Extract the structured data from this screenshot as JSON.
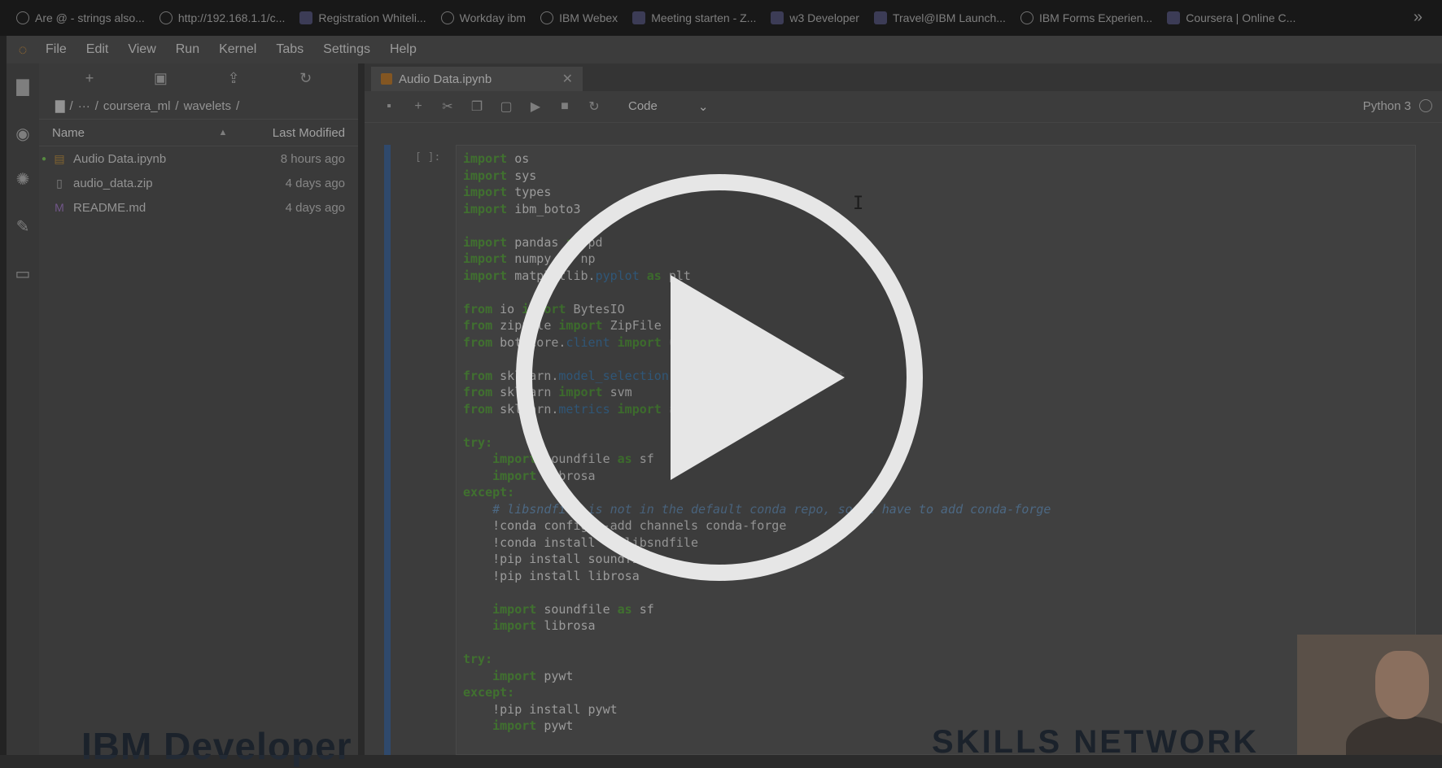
{
  "bookmarks": [
    {
      "label": "Are @ - strings also...",
      "icon": "globe-icon"
    },
    {
      "label": "http://192.168.1.1/c...",
      "icon": "globe-icon"
    },
    {
      "label": "Registration Whiteli...",
      "icon": "page-icon"
    },
    {
      "label": "Workday ibm",
      "icon": "globe-icon"
    },
    {
      "label": "IBM Webex",
      "icon": "webex-icon"
    },
    {
      "label": "Meeting starten - Z...",
      "icon": "zoom-icon"
    },
    {
      "label": "w3 Developer",
      "icon": "w3-icon"
    },
    {
      "label": "Travel@IBM Launch...",
      "icon": "w3-icon"
    },
    {
      "label": "IBM Forms Experien...",
      "icon": "globe-icon"
    },
    {
      "label": "Coursera | Online C...",
      "icon": "coursera-icon"
    }
  ],
  "menu": [
    "File",
    "Edit",
    "View",
    "Run",
    "Kernel",
    "Tabs",
    "Settings",
    "Help"
  ],
  "breadcrumb": {
    "root": "/",
    "ellipsis": "···",
    "sep1": "/",
    "folder1": "coursera_ml",
    "sep2": "/",
    "folder2": "wavelets",
    "sep3": "/"
  },
  "filebrowser": {
    "col_name": "Name",
    "col_modified": "Last Modified",
    "files": [
      {
        "name": "Audio Data.ipynb",
        "modified": "8 hours ago",
        "icon": "notebook-icon",
        "running": true
      },
      {
        "name": "audio_data.zip",
        "modified": "4 days ago",
        "icon": "file-icon",
        "running": false
      },
      {
        "name": "README.md",
        "modified": "4 days ago",
        "icon": "markdown-icon",
        "running": false
      }
    ]
  },
  "tab": {
    "title": "Audio Data.ipynb"
  },
  "toolbar": {
    "cell_type": "Code",
    "kernel": "Python 3"
  },
  "cell": {
    "prompt": "[ ]:"
  },
  "branding": {
    "left": "IBM Developer",
    "right": "SKILLS NETWORK"
  },
  "colors": {
    "cell_active": "#3a5a84",
    "keyword": "#4f8a3a",
    "module": "#3d6f9a",
    "comment": "#5d7fa0"
  }
}
